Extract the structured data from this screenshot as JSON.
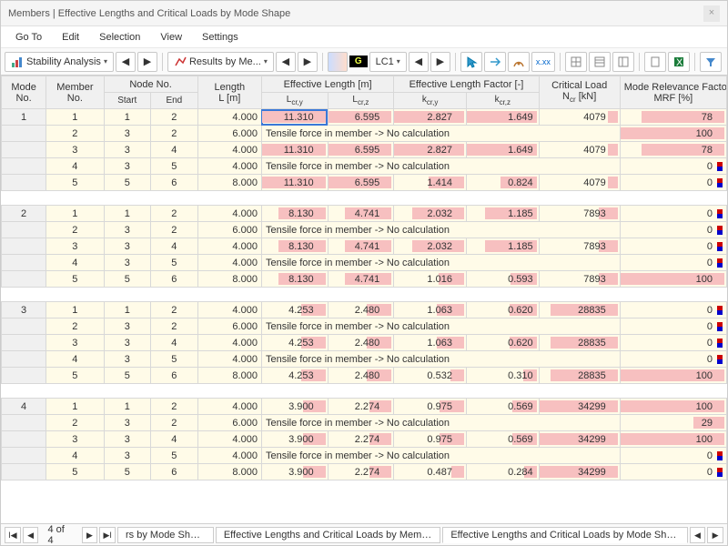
{
  "window": {
    "title": "Members | Effective Lengths and Critical Loads by Mode Shape"
  },
  "menu": {
    "items": [
      "Go To",
      "Edit",
      "Selection",
      "View",
      "Settings"
    ]
  },
  "toolbar": {
    "stability_label": "Stability Analysis",
    "results_label": "Results by Me...",
    "badge_g": "G",
    "loadcase": "LC1"
  },
  "headers": {
    "mode_no": "Mode No.",
    "member_no": "Member No.",
    "node_no": "Node No.",
    "start": "Start",
    "end": "End",
    "length": "Length L [m]",
    "eff_len": "Effective Length [m]",
    "lcry": "Lcr,y",
    "lcrz": "Lcr,z",
    "eff_factor": "Effective Length Factor [-]",
    "kcry": "kcr,y",
    "kcrz": "kcr,z",
    "crit_load": "Critical Load Ncr [kN]",
    "mrf": "Mode Relevance Factor MRF [%]"
  },
  "tensile_msg": "Tensile force in member -> No calculation",
  "modes": [
    {
      "mode": 1,
      "rows": [
        {
          "member": 1,
          "start": 1,
          "end": 2,
          "L": "4.000",
          "lcry": "11.310",
          "lcrz": "6.595",
          "kcry": "2.827",
          "kcrz": "1.649",
          "ncr": "4079",
          "mrf": "78",
          "tensile": false
        },
        {
          "member": 2,
          "start": 3,
          "end": 2,
          "L": "6.000",
          "tensile": true,
          "mrf": "100"
        },
        {
          "member": 3,
          "start": 3,
          "end": 4,
          "L": "4.000",
          "lcry": "11.310",
          "lcrz": "6.595",
          "kcry": "2.827",
          "kcrz": "1.649",
          "ncr": "4079",
          "mrf": "78",
          "tensile": false
        },
        {
          "member": 4,
          "start": 3,
          "end": 5,
          "L": "4.000",
          "tensile": true,
          "mrf": "0"
        },
        {
          "member": 5,
          "start": 5,
          "end": 6,
          "L": "8.000",
          "lcry": "11.310",
          "lcrz": "6.595",
          "kcry": "1.414",
          "kcrz": "0.824",
          "ncr": "4079",
          "mrf": "0",
          "tensile": false
        }
      ]
    },
    {
      "mode": 2,
      "rows": [
        {
          "member": 1,
          "start": 1,
          "end": 2,
          "L": "4.000",
          "lcry": "8.130",
          "lcrz": "4.741",
          "kcry": "2.032",
          "kcrz": "1.185",
          "ncr": "7893",
          "mrf": "0",
          "tensile": false
        },
        {
          "member": 2,
          "start": 3,
          "end": 2,
          "L": "6.000",
          "tensile": true,
          "mrf": "0"
        },
        {
          "member": 3,
          "start": 3,
          "end": 4,
          "L": "4.000",
          "lcry": "8.130",
          "lcrz": "4.741",
          "kcry": "2.032",
          "kcrz": "1.185",
          "ncr": "7893",
          "mrf": "0",
          "tensile": false
        },
        {
          "member": 4,
          "start": 3,
          "end": 5,
          "L": "4.000",
          "tensile": true,
          "mrf": "0"
        },
        {
          "member": 5,
          "start": 5,
          "end": 6,
          "L": "8.000",
          "lcry": "8.130",
          "lcrz": "4.741",
          "kcry": "1.016",
          "kcrz": "0.593",
          "ncr": "7893",
          "mrf": "100",
          "tensile": false
        }
      ]
    },
    {
      "mode": 3,
      "rows": [
        {
          "member": 1,
          "start": 1,
          "end": 2,
          "L": "4.000",
          "lcry": "4.253",
          "lcrz": "2.480",
          "kcry": "1.063",
          "kcrz": "0.620",
          "ncr": "28835",
          "mrf": "0",
          "tensile": false
        },
        {
          "member": 2,
          "start": 3,
          "end": 2,
          "L": "6.000",
          "tensile": true,
          "mrf": "0"
        },
        {
          "member": 3,
          "start": 3,
          "end": 4,
          "L": "4.000",
          "lcry": "4.253",
          "lcrz": "2.480",
          "kcry": "1.063",
          "kcrz": "0.620",
          "ncr": "28835",
          "mrf": "0",
          "tensile": false
        },
        {
          "member": 4,
          "start": 3,
          "end": 5,
          "L": "4.000",
          "tensile": true,
          "mrf": "0"
        },
        {
          "member": 5,
          "start": 5,
          "end": 6,
          "L": "8.000",
          "lcry": "4.253",
          "lcrz": "2.480",
          "kcry": "0.532",
          "kcrz": "0.310",
          "ncr": "28835",
          "mrf": "100",
          "tensile": false
        }
      ]
    },
    {
      "mode": 4,
      "rows": [
        {
          "member": 1,
          "start": 1,
          "end": 2,
          "L": "4.000",
          "lcry": "3.900",
          "lcrz": "2.274",
          "kcry": "0.975",
          "kcrz": "0.569",
          "ncr": "34299",
          "mrf": "100",
          "tensile": false
        },
        {
          "member": 2,
          "start": 3,
          "end": 2,
          "L": "6.000",
          "tensile": true,
          "mrf": "29"
        },
        {
          "member": 3,
          "start": 3,
          "end": 4,
          "L": "4.000",
          "lcry": "3.900",
          "lcrz": "2.274",
          "kcry": "0.975",
          "kcrz": "0.569",
          "ncr": "34299",
          "mrf": "100",
          "tensile": false
        },
        {
          "member": 4,
          "start": 3,
          "end": 5,
          "L": "4.000",
          "tensile": true,
          "mrf": "0"
        },
        {
          "member": 5,
          "start": 5,
          "end": 6,
          "L": "8.000",
          "lcry": "3.900",
          "lcrz": "2.274",
          "kcry": "0.487",
          "kcrz": "0.284",
          "ncr": "34299",
          "mrf": "0",
          "tensile": false
        }
      ]
    }
  ],
  "bars": {
    "lcry_max": 11.31,
    "lcrz_max": 6.595,
    "kcry_max": 2.827,
    "kcrz_max": 1.649,
    "ncr_max": 34299,
    "mrf_max": 100
  },
  "footer": {
    "page": "4 of 4",
    "tabs": [
      "rs by Mode Shape",
      "Effective Lengths and Critical Loads by Member",
      "Effective Lengths and Critical Loads by Mode Shape"
    ]
  }
}
